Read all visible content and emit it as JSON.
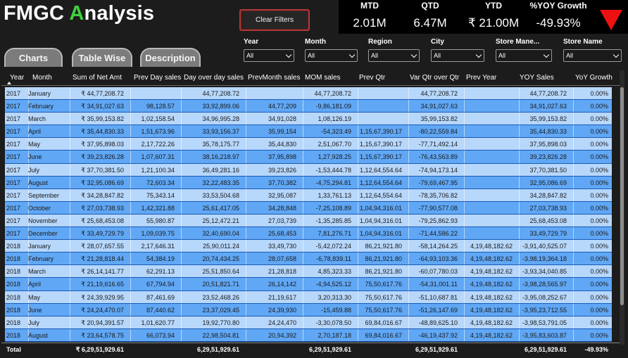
{
  "title": {
    "prefix": "FMGC ",
    "accent": "A",
    "rest": "nalysis"
  },
  "clear_filters_label": "Clear Filters",
  "kpis": [
    {
      "label": "MTD",
      "value": "2.01M"
    },
    {
      "label": "QTD",
      "value": "6.47M"
    },
    {
      "label": "YTD",
      "value": "₹ 21.00M"
    },
    {
      "label": "%YOY Growth",
      "value": "-49.93%"
    }
  ],
  "kpi_trend_icon": "down-triangle-icon",
  "tabs": [
    "Charts",
    "Table Wise",
    "Description"
  ],
  "slicers": [
    {
      "label": "Year",
      "value": "All"
    },
    {
      "label": "Month",
      "value": "All"
    },
    {
      "label": "Region",
      "value": "All"
    },
    {
      "label": "City",
      "value": "All"
    },
    {
      "label": "Store Mane...",
      "value": "All"
    },
    {
      "label": "Store Name",
      "value": "All"
    }
  ],
  "table": {
    "columns": [
      "Year",
      "Month",
      "Sum of Net Amt",
      "Prev Day sales",
      "Day over day sales",
      "PrevMonth sales",
      "MOM sales",
      "Prev Qtr",
      "Var Qtr over Qtr",
      "Prev Year",
      "YOY Sales",
      "YoY Growth"
    ],
    "rows": [
      [
        "2017",
        "January",
        "₹ 44,77,208.72",
        "",
        "44,77,208.72",
        "",
        "44,77,208.72",
        "",
        "44,77,208.72",
        "",
        "44,77,208.72",
        "0.00%"
      ],
      [
        "2017",
        "February",
        "₹ 34,91,027.63",
        "98,128.57",
        "33,92,899.06",
        "44,77,209",
        "-9,86,181.09",
        "",
        "34,91,027.63",
        "",
        "34,91,027.63",
        "0.00%"
      ],
      [
        "2017",
        "March",
        "₹ 35,99,153.82",
        "1,02,158.54",
        "34,96,995.28",
        "34,91,028",
        "1,08,126.19",
        "",
        "35,99,153.82",
        "",
        "35,99,153.82",
        "0.00%"
      ],
      [
        "2017",
        "April",
        "₹ 35,44,830.33",
        "1,51,673.96",
        "33,93,156.37",
        "35,99,154",
        "-54,323.49",
        "1,15,67,390.17",
        "-80,22,559.84",
        "",
        "35,44,830.33",
        "0.00%"
      ],
      [
        "2017",
        "May",
        "₹ 37,95,898.03",
        "2,17,722.26",
        "35,78,175.77",
        "35,44,830",
        "2,51,067.70",
        "1,15,67,390.17",
        "-77,71,492.14",
        "",
        "37,95,898.03",
        "0.00%"
      ],
      [
        "2017",
        "June",
        "₹ 39,23,826.28",
        "1,07,607.31",
        "38,16,218.97",
        "37,95,898",
        "1,27,928.25",
        "1,15,67,390.17",
        "-76,43,563.89",
        "",
        "39,23,826.28",
        "0.00%"
      ],
      [
        "2017",
        "July",
        "₹ 37,70,381.50",
        "1,21,100.34",
        "36,49,281.16",
        "39,23,826",
        "-1,53,444.78",
        "1,12,64,554.64",
        "-74,94,173.14",
        "",
        "37,70,381.50",
        "0.00%"
      ],
      [
        "2017",
        "August",
        "₹ 32,95,086.69",
        "72,603.34",
        "32,22,483.35",
        "37,70,382",
        "-4,75,294.81",
        "1,12,64,554.64",
        "-79,69,467.95",
        "",
        "32,95,086.69",
        "0.00%"
      ],
      [
        "2017",
        "September",
        "₹ 34,28,847.82",
        "75,343.14",
        "33,53,504.68",
        "32,95,087",
        "1,33,761.13",
        "1,12,64,554.64",
        "-78,35,706.82",
        "",
        "34,28,847.82",
        "0.00%"
      ],
      [
        "2017",
        "October",
        "₹ 27,03,738.93",
        "1,42,321.88",
        "25,61,417.05",
        "34,28,848",
        "-7,25,108.89",
        "1,04,94,316.01",
        "-77,90,577.08",
        "",
        "27,03,738.93",
        "0.00%"
      ],
      [
        "2017",
        "November",
        "₹ 25,68,453.08",
        "55,980.87",
        "25,12,472.21",
        "27,03,739",
        "-1,35,285.85",
        "1,04,94,316.01",
        "-79,25,862.93",
        "",
        "25,68,453.08",
        "0.00%"
      ],
      [
        "2017",
        "December",
        "₹ 33,49,729.79",
        "1,09,039.75",
        "32,40,690.04",
        "25,68,453",
        "7,81,276.71",
        "1,04,94,316.01",
        "-71,44,586.22",
        "",
        "33,49,729.79",
        "0.00%"
      ],
      [
        "2018",
        "January",
        "₹ 28,07,657.55",
        "2,17,646.31",
        "25,90,011.24",
        "33,49,730",
        "-5,42,072.24",
        "86,21,921.80",
        "-58,14,264.25",
        "4,19,48,182.62",
        "-3,91,40,525.07",
        "0.00%"
      ],
      [
        "2018",
        "February",
        "₹ 21,28,818.44",
        "54,384.19",
        "20,74,434.25",
        "28,07,658",
        "-6,78,839.11",
        "86,21,921.80",
        "-64,93,103.36",
        "4,19,48,182.62",
        "-3,98,19,364.18",
        "0.00%"
      ],
      [
        "2018",
        "March",
        "₹ 26,14,141.77",
        "62,291.13",
        "25,51,850.64",
        "21,28,818",
        "4,85,323.33",
        "86,21,921.80",
        "-60,07,780.03",
        "4,19,48,182.62",
        "-3,93,34,040.85",
        "0.00%"
      ],
      [
        "2018",
        "April",
        "₹ 21,19,616.65",
        "67,794.94",
        "20,51,821.71",
        "26,14,142",
        "-4,94,525.12",
        "75,50,617.76",
        "-54,31,001.11",
        "4,19,48,182.62",
        "-3,98,28,565.97",
        "0.00%"
      ],
      [
        "2018",
        "May",
        "₹ 24,39,929.95",
        "87,461.69",
        "23,52,468.26",
        "21,19,617",
        "3,20,313.30",
        "75,50,617.76",
        "-51,10,687.81",
        "4,19,48,182.62",
        "-3,95,08,252.67",
        "0.00%"
      ],
      [
        "2018",
        "June",
        "₹ 24,24,470.07",
        "87,440.62",
        "23,37,029.45",
        "24,39,930",
        "-15,459.88",
        "75,50,617.76",
        "-51,26,147.69",
        "4,19,48,182.62",
        "-3,95,23,712.55",
        "0.00%"
      ],
      [
        "2018",
        "July",
        "₹ 20,94,391.57",
        "1,01,620.77",
        "19,92,770.80",
        "24,24,470",
        "-3,30,078.50",
        "69,84,016.67",
        "-48,89,625.10",
        "4,19,48,182.62",
        "-3,98,53,791.05",
        "0.00%"
      ],
      [
        "2018",
        "August",
        "₹ 23,64,578.75",
        "66,073.94",
        "22,98,504.81",
        "20,94,392",
        "2,70,187.18",
        "69,84,016.67",
        "-46,19,437.92",
        "4,19,48,182.62",
        "-3,95,83,603.87",
        "0.00%"
      ]
    ],
    "total": [
      "Total",
      "",
      "₹ 6,29,51,929.61",
      "",
      "6,29,51,929.61",
      "",
      "6,29,51,929.61",
      "",
      "6,29,51,929.61",
      "",
      "6,29,51,929.61",
      "-49.93%"
    ]
  },
  "colors": {
    "row_light": "#b7d7fb",
    "row_dark": "#60a7f5",
    "accent_green": "#3fd13f",
    "trend_red": "#ee1111"
  }
}
